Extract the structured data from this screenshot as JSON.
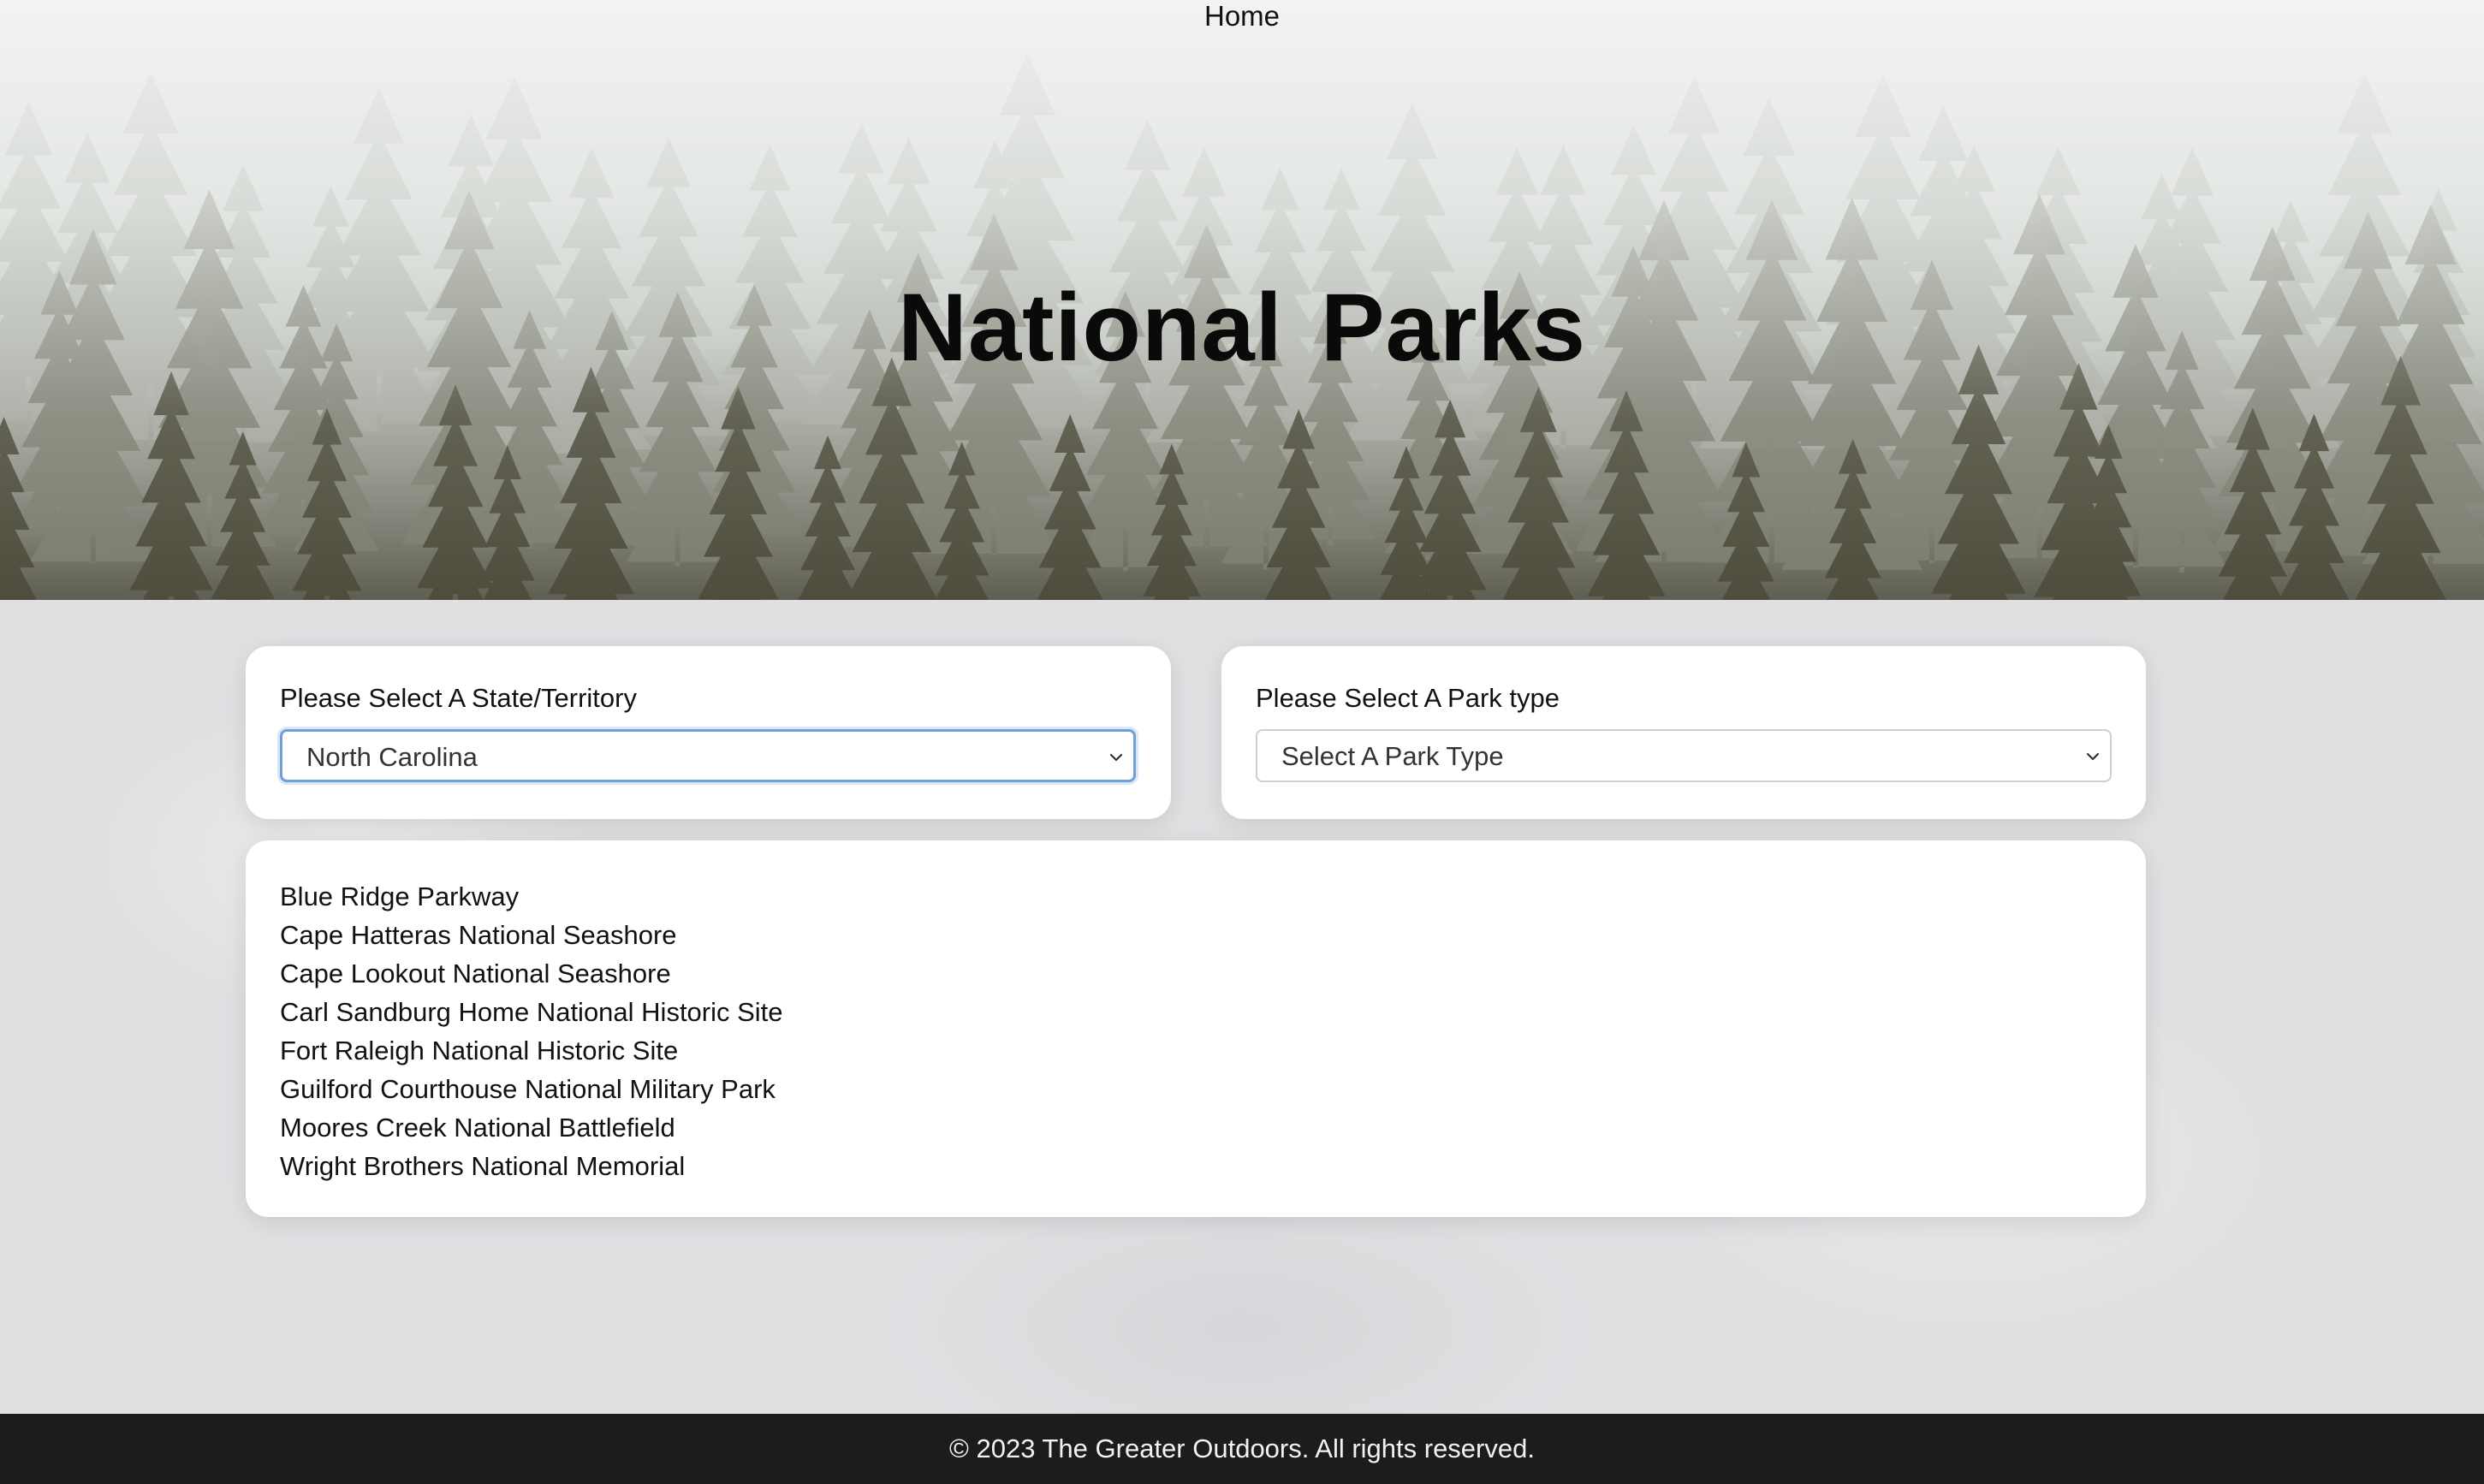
{
  "nav": {
    "home_label": "Home"
  },
  "hero": {
    "title": "National Parks"
  },
  "state_filter": {
    "label": "Please Select A State/Territory",
    "selected_value": "North Carolina"
  },
  "park_type_filter": {
    "label": "Please Select A Park type",
    "selected_value": "Select A Park Type"
  },
  "results": {
    "parks": [
      "Blue Ridge Parkway",
      "Cape Hatteras National Seashore",
      "Cape Lookout National Seashore",
      "Carl Sandburg Home National Historic Site",
      "Fort Raleigh National Historic Site",
      "Guilford Courthouse National Military Park",
      "Moores Creek National Battlefield",
      "Wright Brothers National Memorial"
    ]
  },
  "footer": {
    "copyright": "© 2023 The Greater Outdoors. All rights reserved."
  },
  "icons": {
    "select_chevron": "chevron-down-icon"
  },
  "colors": {
    "footer_bg": "#1c1c1c",
    "focus_ring": "#6e9fd8",
    "card_bg": "#ffffff",
    "page_bg": "#e0dfe2"
  }
}
